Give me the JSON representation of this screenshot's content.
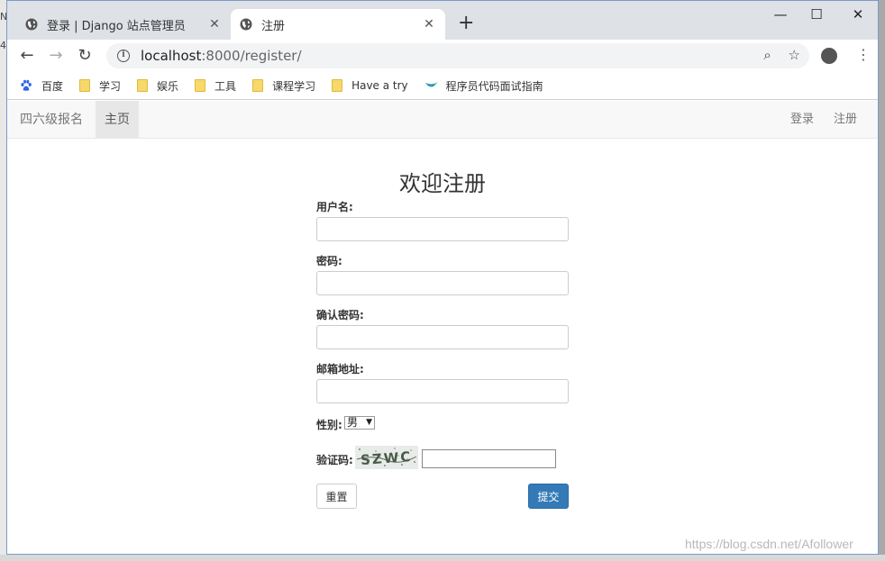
{
  "browser": {
    "tabs": [
      {
        "title": "登录 | Django 站点管理员",
        "active": false
      },
      {
        "title": "注册",
        "active": true
      }
    ],
    "new_tab_label": "+",
    "window_controls": {
      "minimize": "—",
      "maximize": "☐",
      "close": "✕"
    },
    "address": {
      "host": "localhost",
      "path": ":8000/register/"
    },
    "bookmarks": [
      "百度",
      "学习",
      "娱乐",
      "工具",
      "课程学习",
      "Have a try",
      "程序员代码面试指南"
    ]
  },
  "navbar": {
    "brand": "四六级报名",
    "home": "主页",
    "login": "登录",
    "register": "注册"
  },
  "form": {
    "heading": "欢迎注册",
    "username_label": "用户名:",
    "password_label": "密码:",
    "confirm_label": "确认密码:",
    "email_label": "邮箱地址:",
    "gender_label": "性别:",
    "gender_value": "男",
    "captcha_label": "验证码:",
    "captcha_text": "SZWC",
    "reset_label": "重置",
    "submit_label": "提交"
  },
  "watermark": "https://blog.csdn.net/Afollower",
  "desktop_fragments": [
    "N",
    "4"
  ],
  "colors": {
    "primary": "#337ab7",
    "navbar_bg": "#f8f8f8",
    "tabstrip": "#dee1e6"
  }
}
